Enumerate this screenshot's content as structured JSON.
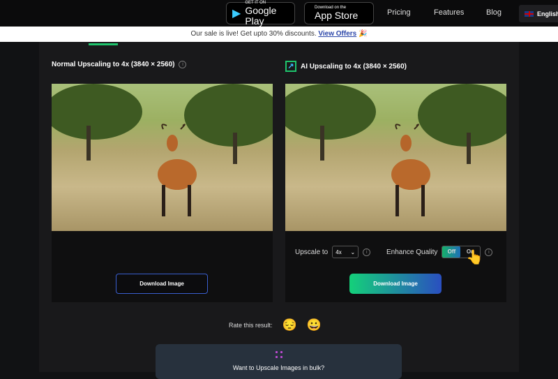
{
  "header": {
    "google_play": {
      "small": "GET IT ON",
      "large": "Google Play"
    },
    "app_store": {
      "small": "Download on the",
      "large": "App Store"
    },
    "nav": [
      "Pricing",
      "Features",
      "Blog"
    ],
    "language": "English"
  },
  "banner": {
    "text": "Our sale is live! Get upto 30% discounts.",
    "link": "View Offers",
    "emoji": "🎉"
  },
  "normal": {
    "title": "Normal Upscaling to 4x (3840 × 2560)",
    "download": "Download Image"
  },
  "ai": {
    "title": "AI Upscaling to 4x (3840 × 2560)",
    "upscale_label": "Upscale to",
    "upscale_value": "4x",
    "enhance_label": "Enhance Quality",
    "toggle_off": "Off",
    "toggle_on": "On",
    "toggle_state": "Off",
    "download": "Download Image"
  },
  "rating": {
    "label": "Rate this result:",
    "bad": "😔",
    "good": "😀"
  },
  "bulk": {
    "text": "Want to Upscale Images in bulk?"
  },
  "colors": {
    "accent_green": "#1ec46c",
    "accent_blue": "#2a4fc0"
  }
}
